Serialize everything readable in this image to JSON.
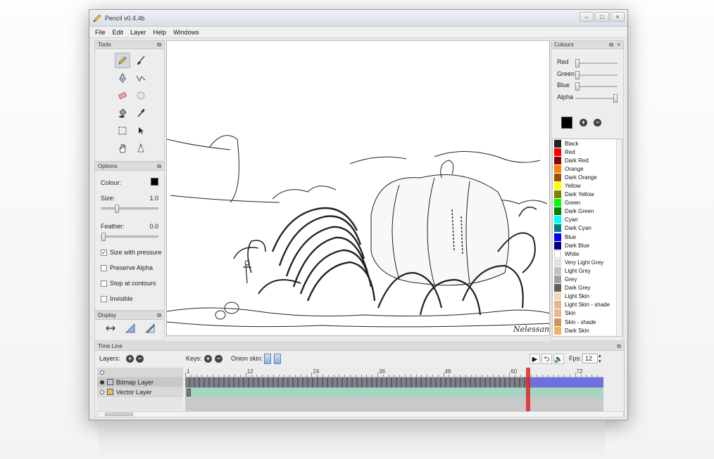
{
  "window": {
    "title": "Pencil v0.4.4b",
    "controls": [
      "–",
      "□",
      "×"
    ]
  },
  "menu": [
    "File",
    "Edit",
    "Layer",
    "Help",
    "Windows"
  ],
  "tools_panel": {
    "title": "Tools",
    "tools": [
      "pencil-icon",
      "brush-icon",
      "pen-icon",
      "polyline-icon",
      "eraser-icon",
      "smudge-icon",
      "bucket-icon",
      "eyedropper-icon",
      "select-icon",
      "move-icon",
      "hand-icon",
      "clear-icon"
    ]
  },
  "options_panel": {
    "title": "Options",
    "colour_label": "Colour:",
    "size_label": "Size:",
    "size_value": "1.0",
    "size_fraction": 0.25,
    "feather_label": "Feather:",
    "feather_value": "0.0",
    "feather_fraction": 0.0,
    "checkboxes": [
      {
        "label": "Size with pressure",
        "checked": true
      },
      {
        "label": "Preserve Alpha",
        "checked": false
      },
      {
        "label": "Stop at contours",
        "checked": false
      },
      {
        "label": "Invisible",
        "checked": false
      }
    ]
  },
  "display_panel": {
    "title": "Display"
  },
  "colours_panel": {
    "title": "Colours",
    "sliders": [
      {
        "label": "Red",
        "fraction": 0.0
      },
      {
        "label": "Green",
        "fraction": 0.0
      },
      {
        "label": "Blue",
        "fraction": 0.0
      },
      {
        "label": "Alpha",
        "fraction": 1.0
      }
    ],
    "palette": [
      {
        "name": "Black",
        "color": "#222222"
      },
      {
        "name": "Red",
        "color": "#ff0000"
      },
      {
        "name": "Dark Red",
        "color": "#8b0000"
      },
      {
        "name": "Orange",
        "color": "#ff8000"
      },
      {
        "name": "Dark Orange",
        "color": "#a05000"
      },
      {
        "name": "Yellow",
        "color": "#ffff00"
      },
      {
        "name": "Dark Yellow",
        "color": "#808000"
      },
      {
        "name": "Green",
        "color": "#00ff00"
      },
      {
        "name": "Dark Green",
        "color": "#008000"
      },
      {
        "name": "Cyan",
        "color": "#00ffff"
      },
      {
        "name": "Dark Cyan",
        "color": "#008080"
      },
      {
        "name": "Blue",
        "color": "#0000ff"
      },
      {
        "name": "Dark Blue",
        "color": "#000080"
      },
      {
        "name": "White",
        "color": "#ffffff"
      },
      {
        "name": "Very Light Grey",
        "color": "#e0e0e0"
      },
      {
        "name": "Light Grey",
        "color": "#c0c0c0"
      },
      {
        "name": "Grey",
        "color": "#a0a0a0"
      },
      {
        "name": "Dark Grey",
        "color": "#606060"
      },
      {
        "name": "Light Skin",
        "color": "#f5d6b4"
      },
      {
        "name": "Light Skin - shade",
        "color": "#e0b890"
      },
      {
        "name": "Skin",
        "color": "#e8b888"
      },
      {
        "name": "Skin - shade",
        "color": "#c89860"
      },
      {
        "name": "Dark Skin",
        "color": "#f0b060"
      }
    ]
  },
  "timeline": {
    "title": "Time Line",
    "layers_label": "Layers:",
    "keys_label": "Keys:",
    "onion_label": "Onion skin:",
    "fps_label": "Fps:",
    "fps_value": "12",
    "ruler_ticks": [
      "1",
      "12",
      "24",
      "36",
      "48",
      "60",
      "72"
    ],
    "current_frame": "63",
    "layers": [
      {
        "name": "Bitmap Layer",
        "type": "bitmap"
      },
      {
        "name": "Vector Layer",
        "type": "vector"
      }
    ]
  },
  "canvas": {
    "signature": "Nelessan"
  }
}
